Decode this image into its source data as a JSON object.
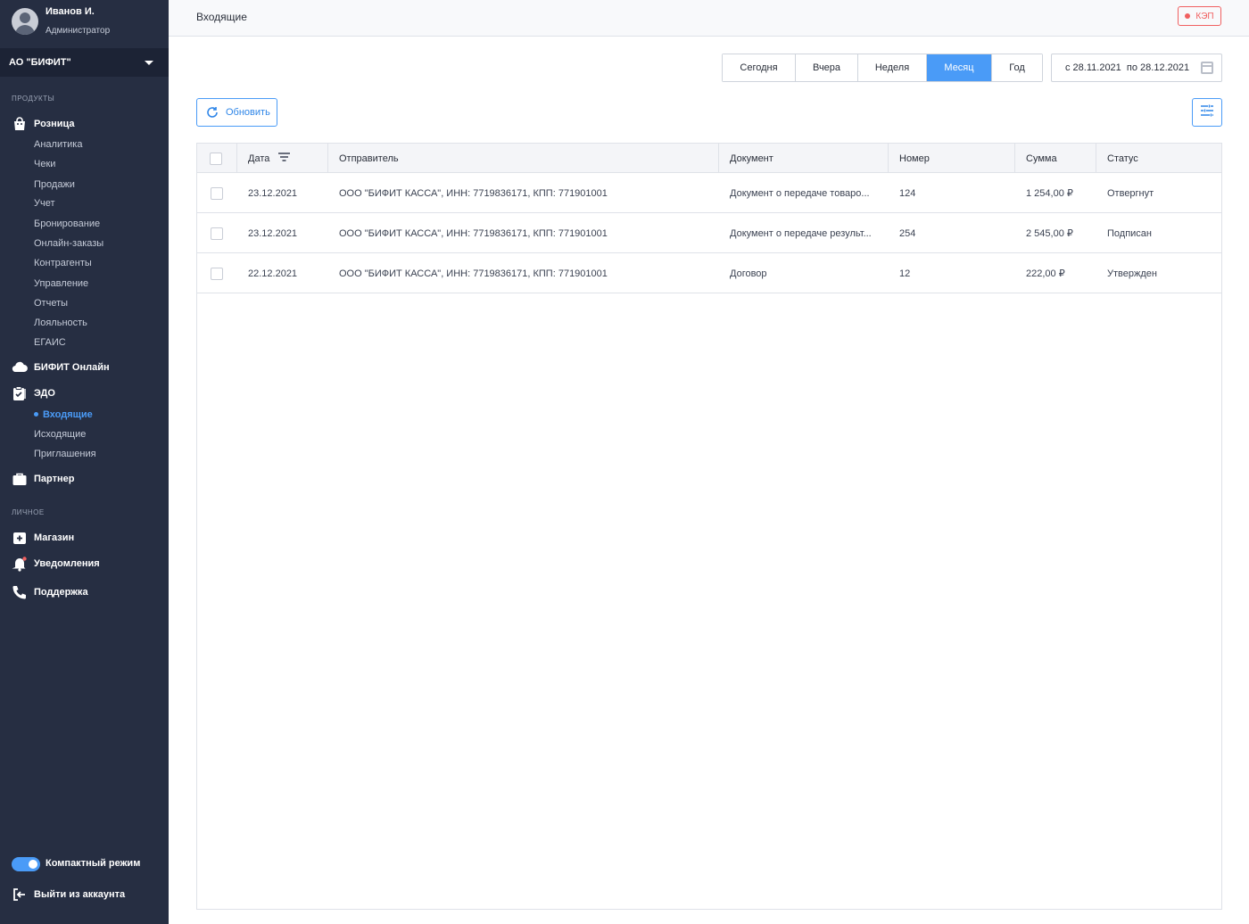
{
  "user": {
    "name": "Иванов И.",
    "role": "Администратор"
  },
  "org": {
    "name": "АО \"БИФИТ\""
  },
  "sidebar": {
    "products_title": "ПРОДУКТЫ",
    "retail": {
      "label": "Розница",
      "items": [
        "Аналитика",
        "Чеки",
        "Продажи",
        "Учет",
        "Бронирование",
        "Онлайн-заказы",
        "Контрагенты",
        "Управление",
        "Отчеты",
        "Лояльность",
        "ЕГАИС"
      ]
    },
    "online": {
      "label": "БИФИТ Онлайн"
    },
    "edo": {
      "label": "ЭДО",
      "items": [
        "Входящие",
        "Исходящие",
        "Приглашения"
      ],
      "active_item": "Входящие"
    },
    "partner": {
      "label": "Партнер"
    },
    "personal_title": "ЛИЧНОЕ",
    "shop": {
      "label": "Магазин"
    },
    "notifications": {
      "label": "Уведомления"
    },
    "support": {
      "label": "Поддержка"
    },
    "compact_mode": {
      "label": "Компактный режим",
      "enabled": true
    },
    "logout": {
      "label": "Выйти из аккаунта"
    }
  },
  "header": {
    "title": "Входящие",
    "kep_label": "КЭП"
  },
  "periods": {
    "items": [
      "Сегодня",
      "Вчера",
      "Неделя",
      "Месяц",
      "Год"
    ],
    "active": "Месяц"
  },
  "daterange": {
    "text": "с 28.11.2021  по 28.12.2021"
  },
  "toolbar": {
    "refresh_label": "Обновить"
  },
  "table": {
    "columns": [
      "Дата",
      "Отправитель",
      "Документ",
      "Номер",
      "Сумма",
      "Статус"
    ],
    "rows": [
      {
        "date": "23.12.2021",
        "sender": "ООО \"БИФИТ КАССА\", ИНН: 7719836171, КПП: 771901001",
        "document": "Документ о передаче товаро...",
        "number": "124",
        "sum": "1 254,00 ₽",
        "status": "Отвергнут"
      },
      {
        "date": "23.12.2021",
        "sender": "ООО \"БИФИТ КАССА\", ИНН: 7719836171, КПП: 771901001",
        "document": "Документ о передаче результ...",
        "number": "254",
        "sum": "2 545,00 ₽",
        "status": "Подписан"
      },
      {
        "date": "22.12.2021",
        "sender": "ООО \"БИФИТ КАССА\", ИНН: 7719836171, КПП: 771901001",
        "document": "Договор",
        "number": "12",
        "sum": "222,00 ₽",
        "status": "Утвержден"
      }
    ]
  },
  "colors": {
    "sidebar_bg": "#262e42",
    "accent": "#4a9bf7",
    "danger": "#f06060"
  }
}
